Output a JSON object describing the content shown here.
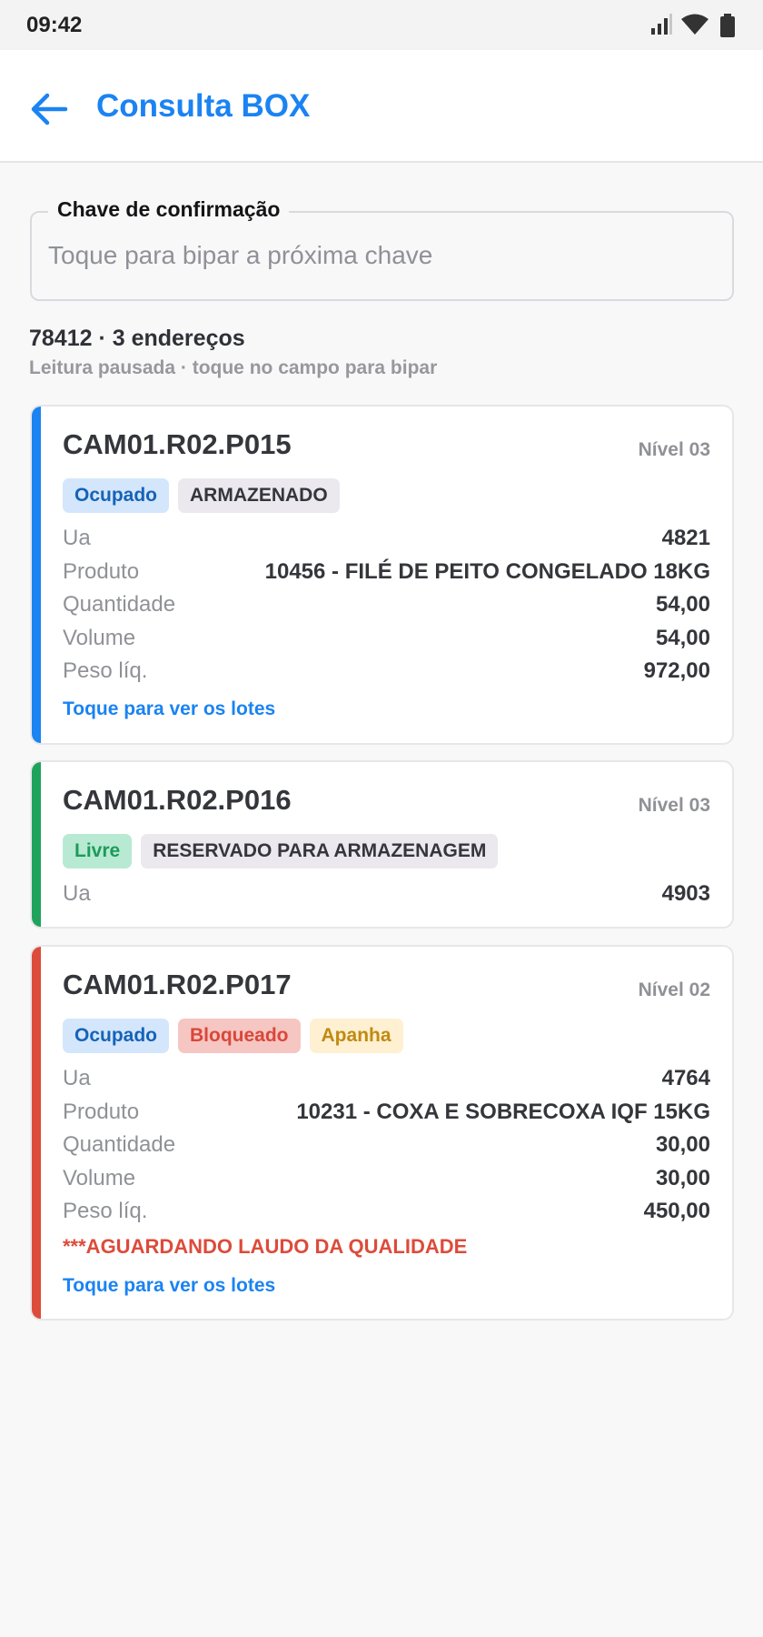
{
  "status_bar": {
    "time": "09:42",
    "icons": [
      "signal-icon",
      "wifi-icon",
      "battery-icon"
    ]
  },
  "header": {
    "back_icon": "arrow-left-icon",
    "title": "Consulta BOX"
  },
  "search": {
    "label": "Chave de confirmação",
    "placeholder": "Toque para bipar a próxima chave",
    "value": ""
  },
  "summary": {
    "line": "78412 · 3 endereços",
    "sub": "Leitura pausada · toque no campo para bipar"
  },
  "colors": {
    "accent": "#1b83f2",
    "occupied": "#1b83f2",
    "free": "#1fa35c",
    "blocked": "#dd4b3a"
  },
  "cards": [
    {
      "address": "CAM01.R02.P015",
      "level": "Nível 03",
      "badges": [
        "Ocupado",
        "ARMAZENADO"
      ],
      "rows": [
        {
          "label": "Ua",
          "value": "4821"
        },
        {
          "label": "Produto",
          "value": "10456 - FILÉ DE PEITO CONGELADO 18KG"
        },
        {
          "label": "Quantidade",
          "value": "54,00"
        },
        {
          "label": "Volume",
          "value": "54,00"
        },
        {
          "label": "Peso líq.",
          "value": "972,00"
        }
      ],
      "link": "Toque para ver os lotes"
    },
    {
      "address": "CAM01.R02.P016",
      "level": "Nível 03",
      "badges": [
        "Livre",
        "RESERVADO PARA ARMAZENAGEM"
      ],
      "rows": [
        {
          "label": "Ua",
          "value": "4903"
        }
      ]
    },
    {
      "address": "CAM01.R02.P017",
      "level": "Nível 02",
      "badges": [
        "Ocupado",
        "Bloqueado",
        "Apanha"
      ],
      "rows": [
        {
          "label": "Ua",
          "value": "4764"
        },
        {
          "label": "Produto",
          "value": "10231 - COXA E SOBRECOXA IQF 15KG"
        },
        {
          "label": "Quantidade",
          "value": "30,00"
        },
        {
          "label": "Volume",
          "value": "30,00"
        },
        {
          "label": "Peso líq.",
          "value": "450,00"
        }
      ],
      "warning": "***AGUARDANDO LAUDO DA QUALIDADE",
      "link": "Toque para ver os lotes"
    }
  ]
}
